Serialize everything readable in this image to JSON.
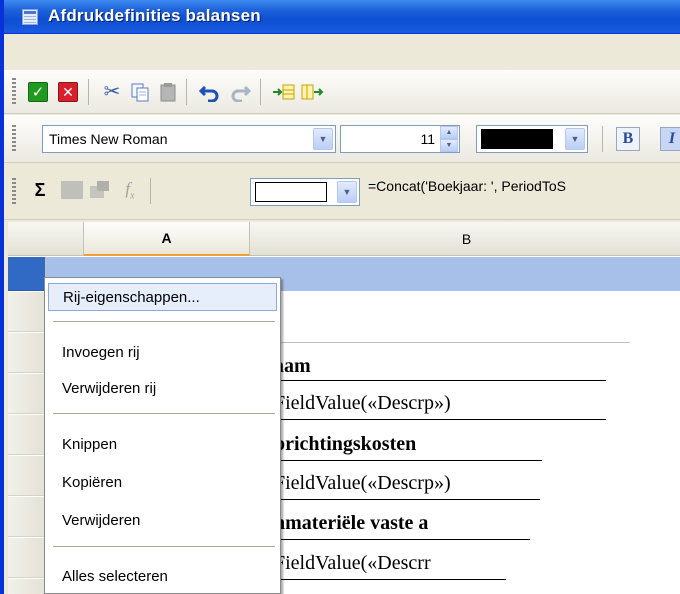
{
  "window": {
    "title": "Afdrukdefinities balansen"
  },
  "toolbar_main": {
    "buttons": [
      {
        "name": "ok",
        "icon": "check-icon"
      },
      {
        "name": "cancel",
        "icon": "close-icon"
      },
      {
        "name": "cut",
        "icon": "scissors-icon"
      },
      {
        "name": "copy",
        "icon": "copy-icon"
      },
      {
        "name": "paste",
        "icon": "paste-icon"
      },
      {
        "name": "undo",
        "icon": "undo-icon"
      },
      {
        "name": "redo",
        "icon": "redo-icon"
      },
      {
        "name": "insert-row",
        "icon": "insert-row-icon"
      },
      {
        "name": "insert-col",
        "icon": "insert-column-icon"
      }
    ]
  },
  "toolbar_format": {
    "font_family": "Times New Roman",
    "font_size": "11",
    "font_color": "#000000",
    "bold_label": "B",
    "italic_label": "I"
  },
  "toolbar_formula": {
    "sum_label": "Σ",
    "fx_label": "f",
    "fx_sub": "x",
    "formula": "=Concat('Boekjaar: ', PeriodToS"
  },
  "sheet": {
    "columns": [
      "A",
      "B"
    ],
    "cells": [
      {
        "text": "aam",
        "bold": true
      },
      {
        "text": "FieldValue(«Descrp»)",
        "bold": false
      },
      {
        "text": "prichtingskosten",
        "bold": true
      },
      {
        "text": "FieldValue(«Descrp»)",
        "bold": false
      },
      {
        "text": "nmateriële vaste a",
        "bold": true
      },
      {
        "text": "FieldValue(«Descrr",
        "bold": false
      }
    ]
  },
  "context_menu": {
    "items": [
      "Rij-eigenschappen...",
      "Invoegen rij",
      "Verwijderen rij",
      "Knippen",
      "Kopiëren",
      "Verwijderen",
      "Alles selecteren"
    ],
    "highlighted": "Rij-eigenschappen..."
  },
  "colors": {
    "titlebar": "#0b4fd2",
    "selection_row": "#a7c0ea",
    "menu_highlight": "#e6eefc"
  }
}
